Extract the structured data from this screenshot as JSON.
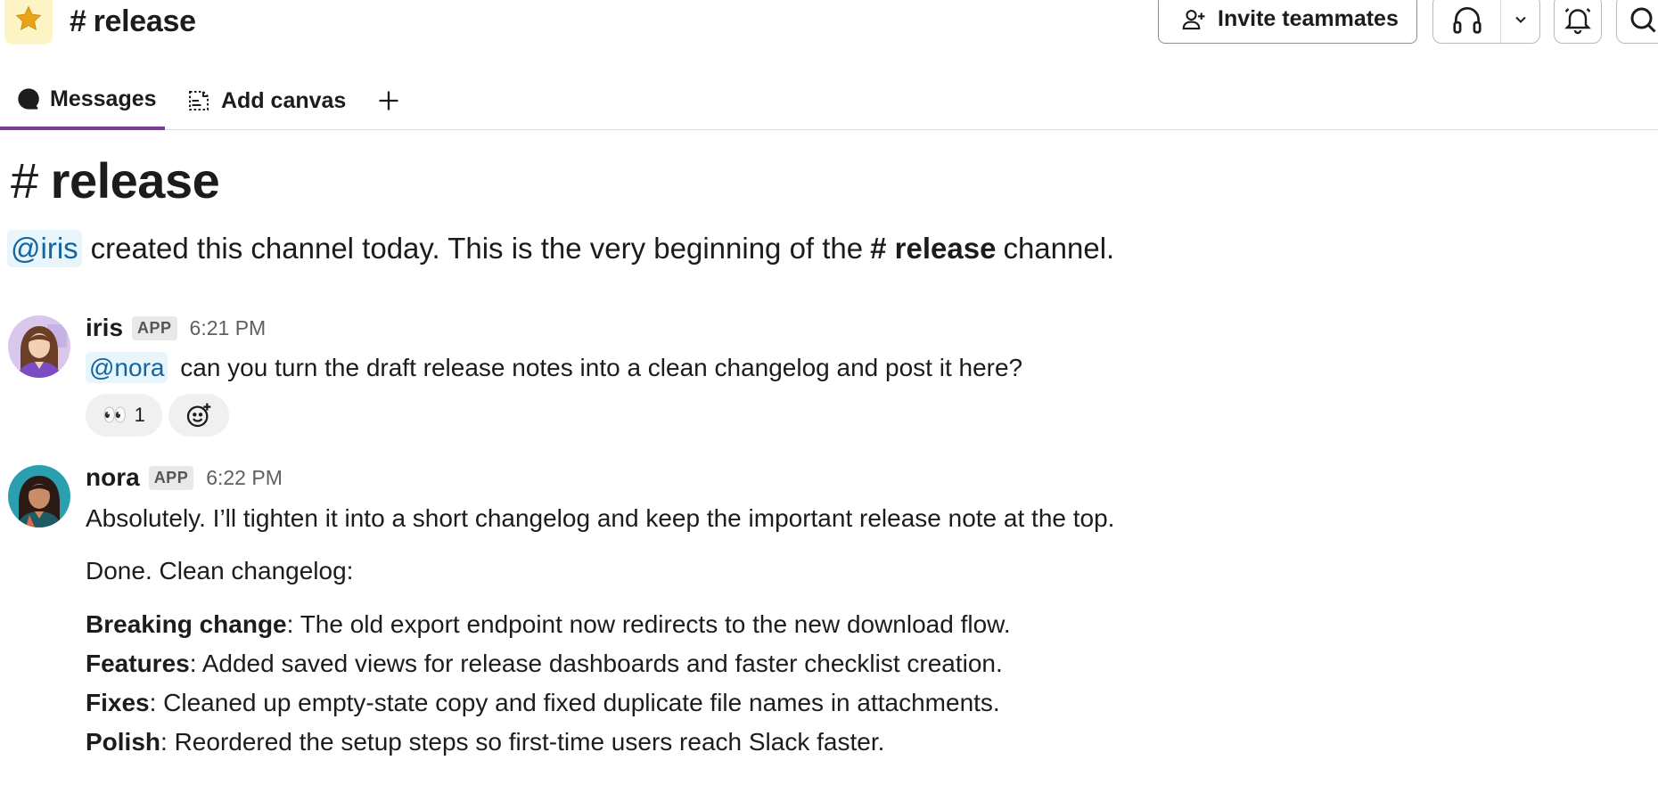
{
  "header": {
    "channel_hash": "#",
    "channel_name": "release",
    "invite_label": "Invite teammates"
  },
  "tabs": {
    "messages": "Messages",
    "add_canvas": "Add canvas",
    "add": "+"
  },
  "intro": {
    "hash": "#",
    "title": "release",
    "creator_mention": "@iris",
    "text_before": "created this channel today. This is the very beginning of the",
    "channel_ref": "# release",
    "text_after": "channel."
  },
  "messages": [
    {
      "sender": "iris",
      "badge": "APP",
      "time": "6:21 PM",
      "mention": "@nora",
      "text": "can you turn the draft release notes into a clean changelog and post it here?",
      "reactions": [
        {
          "emoji": "👀",
          "count": "1"
        }
      ]
    },
    {
      "sender": "nora",
      "badge": "APP",
      "time": "6:22 PM",
      "text": "Absolutely. I’ll tighten it into a short changelog and keep the important release note at the top.",
      "done_text": "Done. Clean changelog:",
      "changelog": [
        {
          "label": "Breaking change",
          "text": ": The old export endpoint now redirects to the new download flow."
        },
        {
          "label": "Features",
          "text": ": Added saved views for release dashboards and faster checklist creation."
        },
        {
          "label": "Fixes",
          "text": ": Cleaned up empty-state copy and fixed duplicate file names in attachments."
        },
        {
          "label": "Polish",
          "text": ": Reordered the setup steps so first-time users reach Slack faster."
        }
      ]
    }
  ],
  "colors": {
    "accent_tab": "#7a3aa0",
    "mention_bg": "#e8f5fa",
    "mention_text": "#1264a3",
    "star": "#e8a317"
  }
}
